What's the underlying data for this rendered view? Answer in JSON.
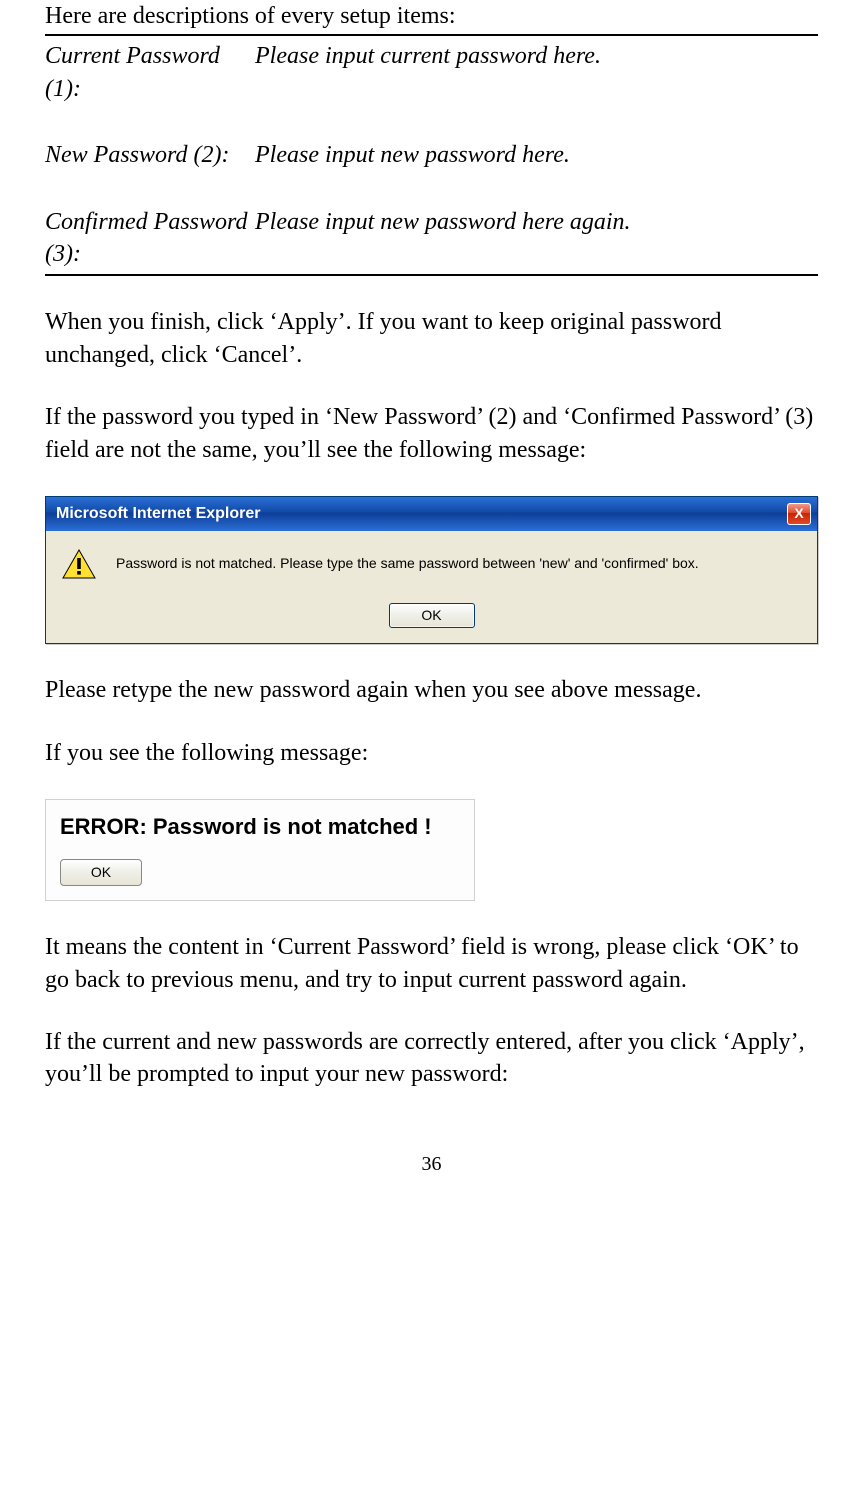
{
  "intro": "Here are descriptions of every setup items:",
  "desc": {
    "row1": {
      "label": "Current Password (1):",
      "text": "Please input current password here."
    },
    "row2": {
      "label": "New Password (2):",
      "text": "Please input new password here."
    },
    "row3": {
      "label": "Confirmed Password (3):",
      "text": "Please input new password here again."
    }
  },
  "para1": "When you finish, click ‘Apply’. If you want to keep original password unchanged, click ‘Cancel’.",
  "para2": "If the password you typed in ‘New Password’ (2) and ‘Confirmed Password’ (3) field are not the same, you’ll see the following message:",
  "dialog1": {
    "title": "Microsoft Internet Explorer",
    "close": "X",
    "message": "Password is not matched. Please type the same password between 'new' and 'confirmed' box.",
    "ok": "OK"
  },
  "para3": "Please retype the new password again when you see above message.",
  "para4": "If you see the following message:",
  "dialog2": {
    "title": "ERROR: Password is not matched !",
    "ok": "OK"
  },
  "para5": "It means the content in ‘Current Password’ field is wrong, please click ‘OK’ to go back to previous menu, and try to input current password again.",
  "para6": "If the current and new passwords are correctly entered, after you click ‘Apply’, you’ll be prompted to input your new password:",
  "pageNumber": "36"
}
